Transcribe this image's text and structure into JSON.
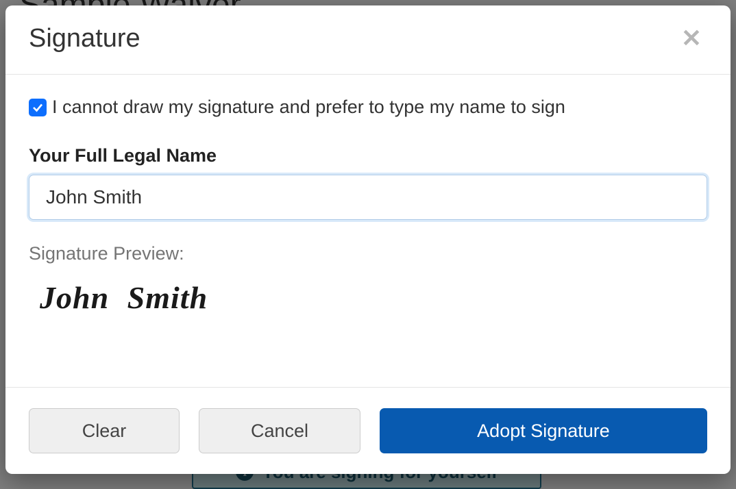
{
  "background": {
    "pageTitle": "Sample Waiver",
    "bannerText": "You are signing for yourself"
  },
  "modal": {
    "title": "Signature",
    "checkbox": {
      "checked": true,
      "label": "I cannot draw my signature and prefer to type my name to sign"
    },
    "nameField": {
      "label": "Your Full Legal Name",
      "value": "John Smith"
    },
    "preview": {
      "label": "Signature Preview:",
      "value": "John Smith"
    },
    "buttons": {
      "clear": "Clear",
      "cancel": "Cancel",
      "adopt": "Adopt Signature"
    }
  }
}
